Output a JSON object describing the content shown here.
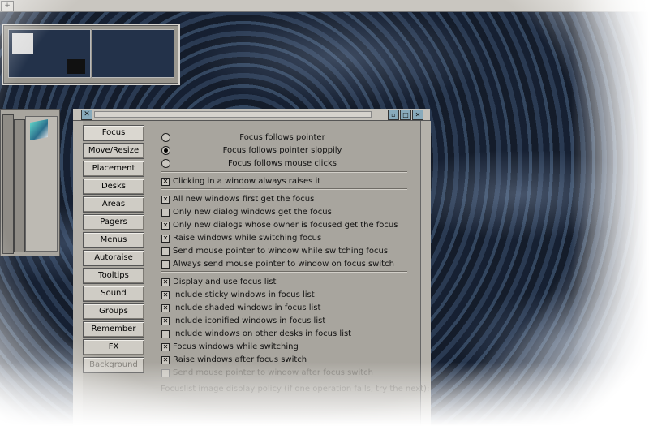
{
  "topbar": {
    "menu_glyph": "+"
  },
  "dialog": {
    "tabs": [
      {
        "label": "Focus",
        "state": "active"
      },
      {
        "label": "Move/Resize",
        "state": "normal"
      },
      {
        "label": "Placement",
        "state": "normal"
      },
      {
        "label": "Desks",
        "state": "normal"
      },
      {
        "label": "Areas",
        "state": "normal"
      },
      {
        "label": "Pagers",
        "state": "normal"
      },
      {
        "label": "Menus",
        "state": "normal"
      },
      {
        "label": "Autoraise",
        "state": "normal"
      },
      {
        "label": "Tooltips",
        "state": "normal"
      },
      {
        "label": "Sound",
        "state": "normal"
      },
      {
        "label": "Groups",
        "state": "normal"
      },
      {
        "label": "Remember",
        "state": "normal"
      },
      {
        "label": "FX",
        "state": "normal"
      },
      {
        "label": "Background",
        "state": "disabled"
      }
    ],
    "focus_modes": [
      {
        "label": "Focus follows pointer",
        "selected": false
      },
      {
        "label": "Focus follows pointer sloppily",
        "selected": true
      },
      {
        "label": "Focus follows mouse clicks",
        "selected": false
      }
    ],
    "options": [
      {
        "label": "Clicking in a window always raises it",
        "checked": true,
        "dim": false
      },
      {
        "label": "All new windows first get the focus",
        "checked": true,
        "dim": false
      },
      {
        "label": "Only new dialog windows get the focus",
        "checked": false,
        "dim": false
      },
      {
        "label": "Only new dialogs whose owner is focused get the focus",
        "checked": true,
        "dim": false
      },
      {
        "label": "Raise windows while switching focus",
        "checked": true,
        "dim": false
      },
      {
        "label": "Send mouse pointer to window while switching focus",
        "checked": false,
        "dim": false
      },
      {
        "label": "Always send mouse pointer to window on focus switch",
        "checked": false,
        "dim": false
      },
      {
        "label": "Display and use focus list",
        "checked": true,
        "dim": false
      },
      {
        "label": "Include sticky windows in focus list",
        "checked": true,
        "dim": false
      },
      {
        "label": "Include shaded windows in focus list",
        "checked": true,
        "dim": false
      },
      {
        "label": "Include iconified windows in focus list",
        "checked": true,
        "dim": false
      },
      {
        "label": "Include windows on other desks in focus list",
        "checked": false,
        "dim": false
      },
      {
        "label": "Focus windows while switching",
        "checked": true,
        "dim": false
      },
      {
        "label": "Raise windows after focus switch",
        "checked": true,
        "dim": false
      },
      {
        "label": "Send mouse pointer to window after focus switch",
        "checked": false,
        "dim": true
      }
    ],
    "footer_text": "Focuslist image display policy (if one operation fails, try the next):"
  },
  "colors": {
    "panel": "#a8a59e",
    "button": "#cfccc5",
    "frame": "#b5b2ab"
  }
}
